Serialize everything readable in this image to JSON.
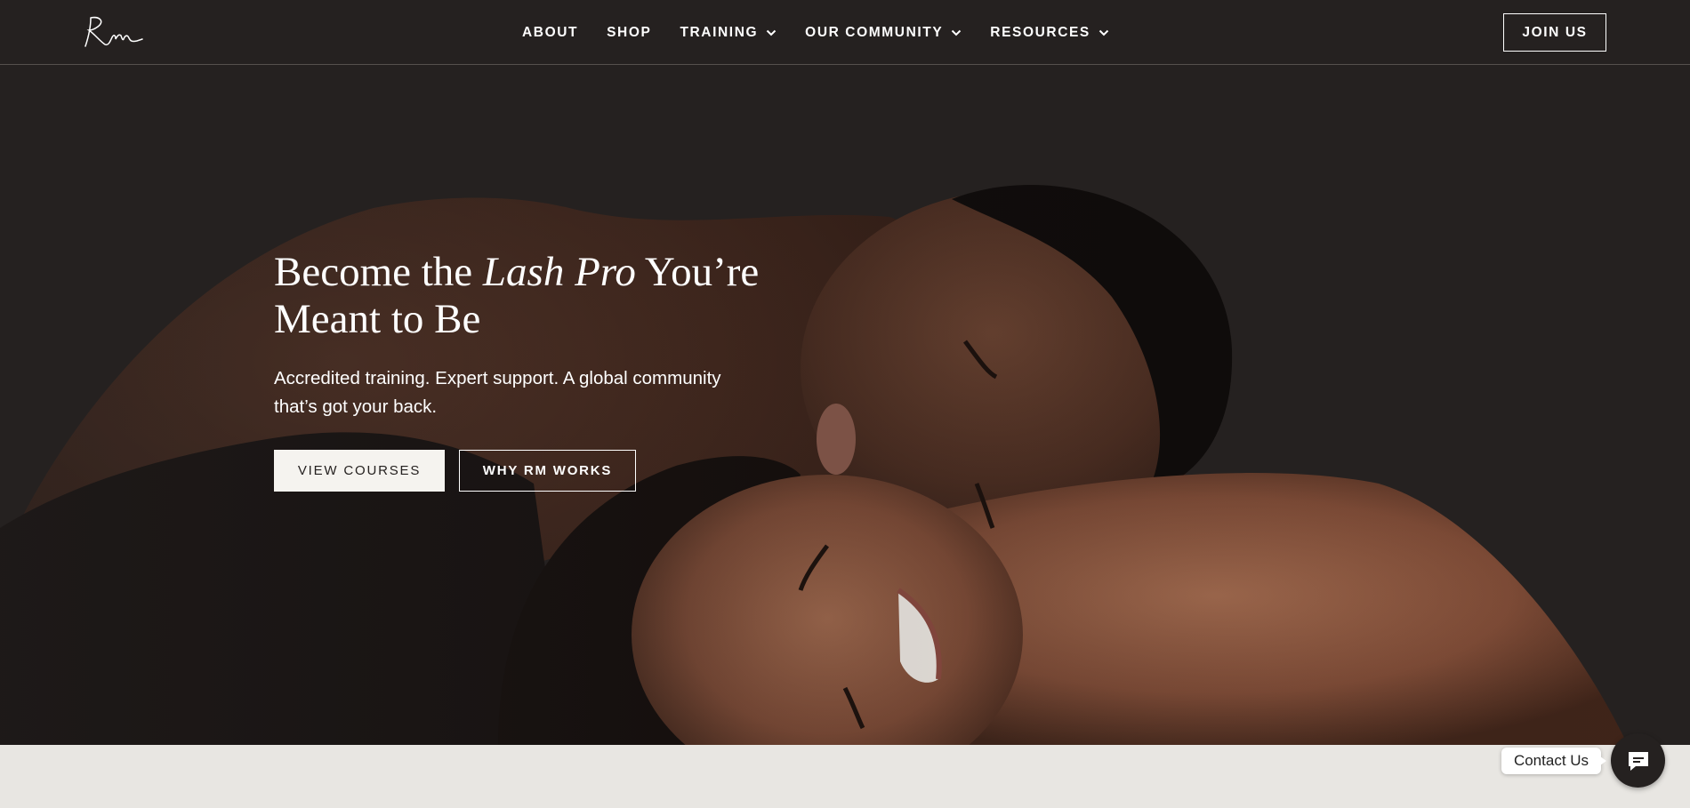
{
  "brand": {
    "logo_text": "Rm"
  },
  "nav": {
    "items": [
      {
        "label": "ABOUT",
        "has_dropdown": false
      },
      {
        "label": "SHOP",
        "has_dropdown": false
      },
      {
        "label": "TRAINING",
        "has_dropdown": true
      },
      {
        "label": "OUR COMMUNITY",
        "has_dropdown": true
      },
      {
        "label": "RESOURCES",
        "has_dropdown": true
      }
    ],
    "cta": "JOIN US"
  },
  "hero": {
    "title_pre": "Become the ",
    "title_em": "Lash Pro",
    "title_post_1": " You’re",
    "title_post_2": "Meant to Be",
    "subtitle_line1": "Accredited training. Expert support. A global community",
    "subtitle_line2": "that’s got your back.",
    "primary_button": "VIEW COURSES",
    "secondary_button": "WHY RM WORKS",
    "image_icon": "two-women-portrait-image"
  },
  "contact": {
    "label": "Contact Us",
    "icon": "chat-icon"
  },
  "colors": {
    "background": "#252120",
    "text": "#ffffff",
    "button_light": "#f5f3ef",
    "band": "#e8e6e2"
  }
}
